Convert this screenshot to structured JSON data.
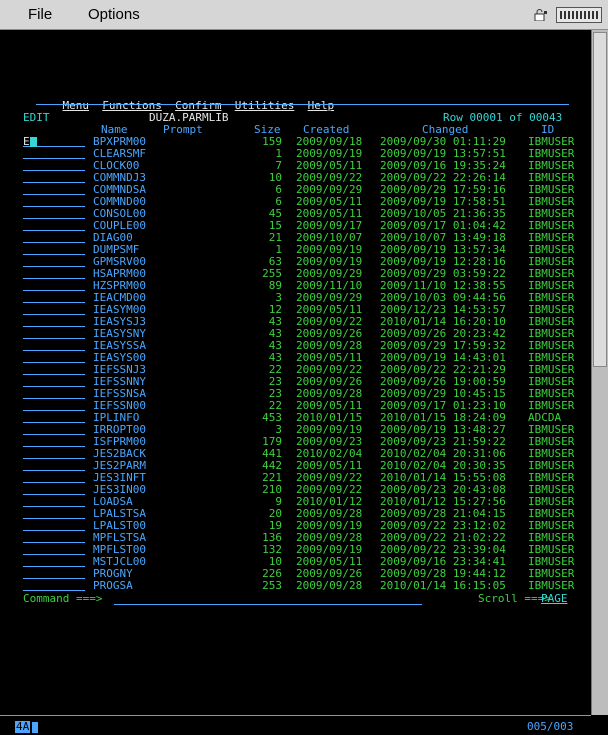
{
  "menubar": {
    "file": "File",
    "options": "Options"
  },
  "pulldown": [
    "Menu",
    "Functions",
    "Confirm",
    "Utilities",
    "Help"
  ],
  "header": {
    "mode": "EDIT",
    "dataset": "DUZA.PARMLIB",
    "row_info": "Row 00001 of 00043",
    "col_name": "Name",
    "col_prompt": "Prompt",
    "col_size": "Size",
    "col_created": "Created",
    "col_changed": "Changed",
    "col_id": "ID"
  },
  "first_cmd": "E",
  "rows": [
    {
      "name": "BPXPRM00",
      "size": "159",
      "created": "2009/09/18",
      "changed": "2009/09/30 01:11:29",
      "id": "IBMUSER"
    },
    {
      "name": "CLEARSMF",
      "size": "1",
      "created": "2009/09/19",
      "changed": "2009/09/19 13:57:51",
      "id": "IBMUSER"
    },
    {
      "name": "CLOCK00",
      "size": "7",
      "created": "2009/05/11",
      "changed": "2009/09/16 19:35:24",
      "id": "IBMUSER"
    },
    {
      "name": "COMMNDJ3",
      "size": "10",
      "created": "2009/09/22",
      "changed": "2009/09/22 22:26:14",
      "id": "IBMUSER"
    },
    {
      "name": "COMMNDSA",
      "size": "6",
      "created": "2009/09/29",
      "changed": "2009/09/29 17:59:16",
      "id": "IBMUSER"
    },
    {
      "name": "COMMND00",
      "size": "6",
      "created": "2009/05/11",
      "changed": "2009/09/19 17:58:51",
      "id": "IBMUSER"
    },
    {
      "name": "CONSOL00",
      "size": "45",
      "created": "2009/05/11",
      "changed": "2009/10/05 21:36:35",
      "id": "IBMUSER"
    },
    {
      "name": "COUPLE00",
      "size": "15",
      "created": "2009/09/17",
      "changed": "2009/09/17 01:04:42",
      "id": "IBMUSER"
    },
    {
      "name": "DIAG00",
      "size": "21",
      "created": "2009/10/07",
      "changed": "2009/10/07 13:49:18",
      "id": "IBMUSER"
    },
    {
      "name": "DUMPSMF",
      "size": "1",
      "created": "2009/09/19",
      "changed": "2009/09/19 13:57:34",
      "id": "IBMUSER"
    },
    {
      "name": "GPMSRV00",
      "size": "63",
      "created": "2009/09/19",
      "changed": "2009/09/19 12:28:16",
      "id": "IBMUSER"
    },
    {
      "name": "HSAPRM00",
      "size": "255",
      "created": "2009/09/29",
      "changed": "2009/09/29 03:59:22",
      "id": "IBMUSER"
    },
    {
      "name": "HZSPRM00",
      "size": "89",
      "created": "2009/11/10",
      "changed": "2009/11/10 12:38:55",
      "id": "IBMUSER"
    },
    {
      "name": "IEACMD00",
      "size": "3",
      "created": "2009/09/29",
      "changed": "2009/10/03 09:44:56",
      "id": "IBMUSER"
    },
    {
      "name": "IEASYM00",
      "size": "12",
      "created": "2009/05/11",
      "changed": "2009/12/23 14:53:57",
      "id": "IBMUSER"
    },
    {
      "name": "IEASYSJ3",
      "size": "43",
      "created": "2009/09/22",
      "changed": "2010/01/14 16:20:10",
      "id": "IBMUSER"
    },
    {
      "name": "IEASYSNY",
      "size": "43",
      "created": "2009/09/26",
      "changed": "2009/09/26 20:23:42",
      "id": "IBMUSER"
    },
    {
      "name": "IEASYSSA",
      "size": "43",
      "created": "2009/09/28",
      "changed": "2009/09/29 17:59:32",
      "id": "IBMUSER"
    },
    {
      "name": "IEASYS00",
      "size": "43",
      "created": "2009/05/11",
      "changed": "2009/09/19 14:43:01",
      "id": "IBMUSER"
    },
    {
      "name": "IEFSSNJ3",
      "size": "22",
      "created": "2009/09/22",
      "changed": "2009/09/22 22:21:29",
      "id": "IBMUSER"
    },
    {
      "name": "IEFSSNNY",
      "size": "23",
      "created": "2009/09/26",
      "changed": "2009/09/26 19:00:59",
      "id": "IBMUSER"
    },
    {
      "name": "IEFSSNSA",
      "size": "23",
      "created": "2009/09/28",
      "changed": "2009/09/29 10:45:15",
      "id": "IBMUSER"
    },
    {
      "name": "IEFSSN00",
      "size": "22",
      "created": "2009/05/11",
      "changed": "2009/09/17 01:23:10",
      "id": "IBMUSER"
    },
    {
      "name": "IPLINFO",
      "size": "453",
      "created": "2010/01/15",
      "changed": "2010/01/15 18:24:09",
      "id": "ADCDA"
    },
    {
      "name": "IRROPT00",
      "size": "3",
      "created": "2009/09/19",
      "changed": "2009/09/19 13:48:27",
      "id": "IBMUSER"
    },
    {
      "name": "ISFPRM00",
      "size": "179",
      "created": "2009/09/23",
      "changed": "2009/09/23 21:59:22",
      "id": "IBMUSER"
    },
    {
      "name": "JES2BACK",
      "size": "441",
      "created": "2010/02/04",
      "changed": "2010/02/04 20:31:06",
      "id": "IBMUSER"
    },
    {
      "name": "JES2PARM",
      "size": "442",
      "created": "2009/05/11",
      "changed": "2010/02/04 20:30:35",
      "id": "IBMUSER"
    },
    {
      "name": "JES3INFT",
      "size": "221",
      "created": "2009/09/22",
      "changed": "2010/01/14 15:55:08",
      "id": "IBMUSER"
    },
    {
      "name": "JES3IN00",
      "size": "210",
      "created": "2009/09/22",
      "changed": "2009/09/23 20:43:08",
      "id": "IBMUSER"
    },
    {
      "name": "LOADSA",
      "size": "9",
      "created": "2010/01/12",
      "changed": "2010/01/12 15:27:56",
      "id": "IBMUSER"
    },
    {
      "name": "LPALSTSA",
      "size": "20",
      "created": "2009/09/28",
      "changed": "2009/09/28 21:04:15",
      "id": "IBMUSER"
    },
    {
      "name": "LPALST00",
      "size": "19",
      "created": "2009/09/19",
      "changed": "2009/09/22 23:12:02",
      "id": "IBMUSER"
    },
    {
      "name": "MPFLSTSA",
      "size": "136",
      "created": "2009/09/28",
      "changed": "2009/09/22 21:02:22",
      "id": "IBMUSER"
    },
    {
      "name": "MPFLST00",
      "size": "132",
      "created": "2009/09/19",
      "changed": "2009/09/22 23:39:04",
      "id": "IBMUSER"
    },
    {
      "name": "MSTJCL00",
      "size": "10",
      "created": "2009/05/11",
      "changed": "2009/09/16 23:34:41",
      "id": "IBMUSER"
    },
    {
      "name": "PROGNY",
      "size": "226",
      "created": "2009/09/26",
      "changed": "2009/09/28 19:44:12",
      "id": "IBMUSER"
    },
    {
      "name": "PROGSA",
      "size": "253",
      "created": "2009/09/28",
      "changed": "2010/01/14 16:15:05",
      "id": "IBMUSER"
    }
  ],
  "command": {
    "label": "Command ===>",
    "value": ""
  },
  "scroll": {
    "label": "Scroll ===>",
    "value": "PAGE"
  },
  "status": {
    "session": "4A",
    "cursor_pos": "005/003"
  },
  "colors": {
    "blue": "#4aa6ff",
    "green": "#3ed13e",
    "white": "#e6e6e6",
    "cyan": "#35d6d6"
  }
}
